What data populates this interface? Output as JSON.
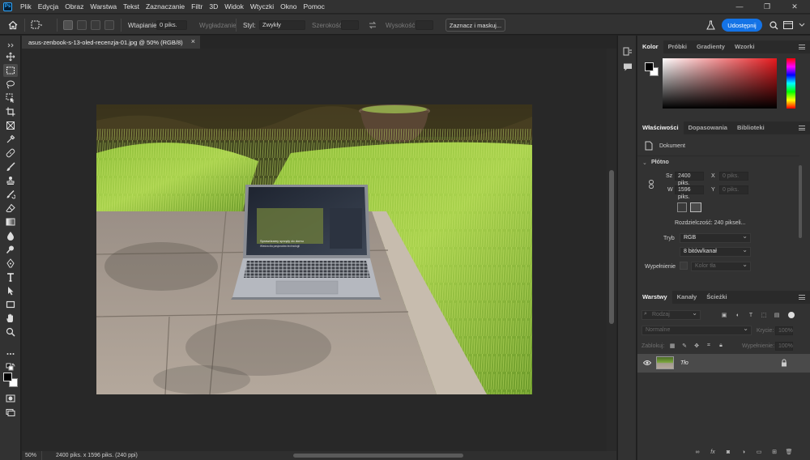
{
  "menu": {
    "items": [
      "Plik",
      "Edycja",
      "Obraz",
      "Warstwa",
      "Tekst",
      "Zaznaczanie",
      "Filtr",
      "3D",
      "Widok",
      "Wtyczki",
      "Okno",
      "Pomoc"
    ]
  },
  "options_bar": {
    "feather_label": "Wtapianie:",
    "feather_value": "0 piks.",
    "antialias_label": "Wygładzanie",
    "style_label": "Styl:",
    "style_value": "Zwykły",
    "width_label": "Szerokość:",
    "height_label": "Wysokość:",
    "select_mask_label": "Zaznacz i maskuj...",
    "share_label": "Udostępnij"
  },
  "document": {
    "tab_title": "asus-zenbook-s-13-oled-recenzja-01.jpg @ 50% (RGB/8)",
    "zoom": "50%",
    "doc_info": "2400 piks. x 1596 piks. (240 ppi)"
  },
  "laptop_screen": {
    "headline_1": "Sprawdzamy sprzęty do domu",
    "headline_2": "Wiedza dla pasjonatów technologii"
  },
  "color_panel": {
    "tabs": [
      "Kolor",
      "Próbki",
      "Gradienty",
      "Wzorki"
    ]
  },
  "properties_panel": {
    "tabs": [
      "Właściwości",
      "Dopasowania",
      "Biblioteki"
    ],
    "doc_label": "Dokument",
    "canvas_section": "Płótno",
    "w_label": "Sz",
    "w_value": "2400 piks.",
    "h_label": "W",
    "h_value": "1596 piks.",
    "x_label": "X",
    "x_value": "0 piks.",
    "y_label": "Y",
    "y_value": "0 piks.",
    "resolution": "Rozdzielczość: 240 pikseli...",
    "mode_label": "Tryb",
    "mode_value": "RGB",
    "bits_value": "8 bitów/kanał",
    "fill_label": "Wypełnienie",
    "fill_value": "Kolor tła"
  },
  "layers_panel": {
    "tabs": [
      "Warstwy",
      "Kanały",
      "Ścieżki"
    ],
    "filter_value": "Rodzaj",
    "blend_mode": "Normalne",
    "opacity_label": "Krycie:",
    "opacity_value": "100%",
    "lock_label": "Zablokuj:",
    "fill_label": "Wypełnienie:",
    "fill_value": "100%",
    "layer_name": "Tło"
  },
  "colors": {
    "accent": "#1473e6",
    "panel_bg": "#323232",
    "canvas_bg": "#282828"
  }
}
